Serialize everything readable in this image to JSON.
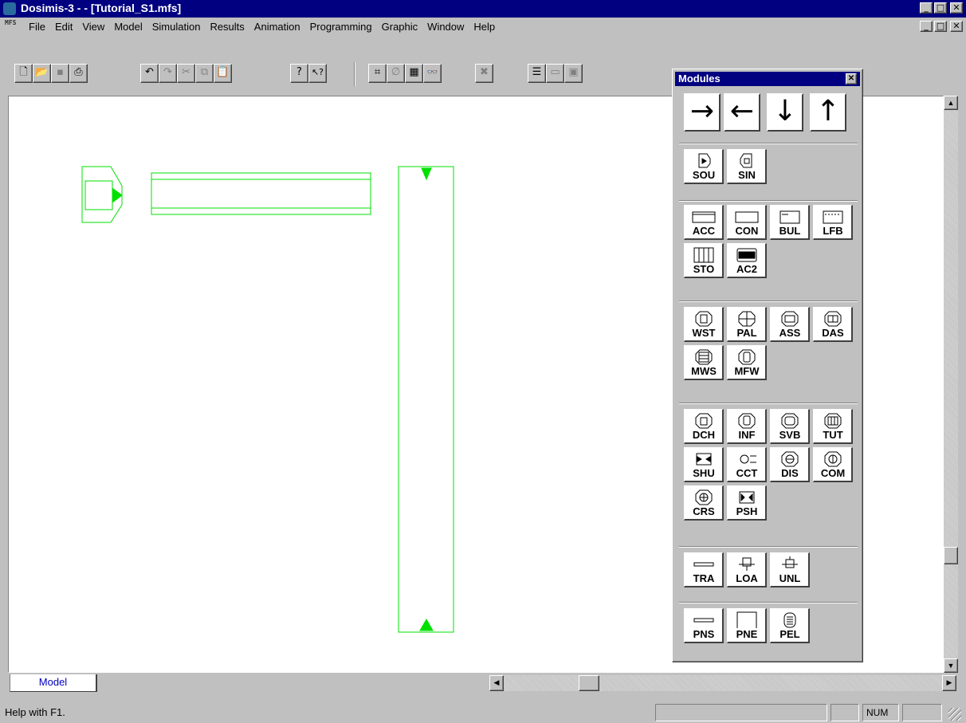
{
  "window": {
    "title": "Dosimis-3 -  - [Tutorial_S1.mfs]",
    "min": "_",
    "max": "□",
    "close": "✕",
    "mdi_icon": "MFS"
  },
  "menu": [
    "File",
    "Edit",
    "View",
    "Model",
    "Simulation",
    "Results",
    "Animation",
    "Programming",
    "Graphic",
    "Window",
    "Help"
  ],
  "toolbar": {
    "buttons": [
      {
        "name": "new-icon",
        "glyph": "🗋"
      },
      {
        "name": "open-icon",
        "glyph": "📂"
      },
      {
        "name": "save-icon",
        "glyph": "▪"
      },
      {
        "name": "print-icon",
        "glyph": "⎙"
      },
      {
        "name": "undo-icon",
        "glyph": "↶"
      },
      {
        "name": "redo-icon",
        "glyph": "↷"
      },
      {
        "name": "cut-icon",
        "glyph": "✂"
      },
      {
        "name": "copy-icon",
        "glyph": "⧉"
      },
      {
        "name": "paste-icon",
        "glyph": "📋"
      },
      {
        "name": "about-icon",
        "glyph": "?"
      },
      {
        "name": "context-help-icon",
        "glyph": "↖?"
      },
      {
        "name": "object-properties-icon",
        "glyph": "⌗"
      },
      {
        "name": "disabled-tool-icon",
        "glyph": "∅"
      },
      {
        "name": "grid-icon",
        "glyph": "▦"
      },
      {
        "name": "find-icon",
        "glyph": "👓"
      },
      {
        "name": "delete-icon",
        "glyph": "✖"
      },
      {
        "name": "list-icon",
        "glyph": "☰"
      },
      {
        "name": "window-icon",
        "glyph": "▭"
      },
      {
        "name": "picture-icon",
        "glyph": "▣"
      }
    ]
  },
  "modules_palette": {
    "title": "Modules",
    "close": "✕",
    "directions": [
      {
        "name": "arrow-right-icon",
        "glyph": "→"
      },
      {
        "name": "arrow-left-icon",
        "glyph": "←"
      },
      {
        "name": "arrow-down-icon",
        "glyph": "↓"
      },
      {
        "name": "arrow-up-icon",
        "glyph": "↑"
      }
    ],
    "groups": [
      [
        "SOU",
        "SIN"
      ],
      [
        "ACC",
        "CON",
        "BUL",
        "LFB",
        "STO",
        "AC2"
      ],
      [
        "WST",
        "PAL",
        "ASS",
        "DAS",
        "MWS",
        "MFW"
      ],
      [
        "DCH",
        "INF",
        "SVB",
        "TUT",
        "SHU",
        "CCT",
        "DIS",
        "COM",
        "CRS",
        "PSH"
      ],
      [
        "TRA",
        "LOA",
        "UNL"
      ],
      [
        "PNS",
        "PNE",
        "PEL"
      ]
    ]
  },
  "tabs": {
    "model": "Model"
  },
  "status": {
    "help": "Help with F1.",
    "num": "NUM"
  },
  "colors": {
    "model_element": "#00e000",
    "titlebar": "#000080",
    "tab_text": "#0000c0"
  }
}
